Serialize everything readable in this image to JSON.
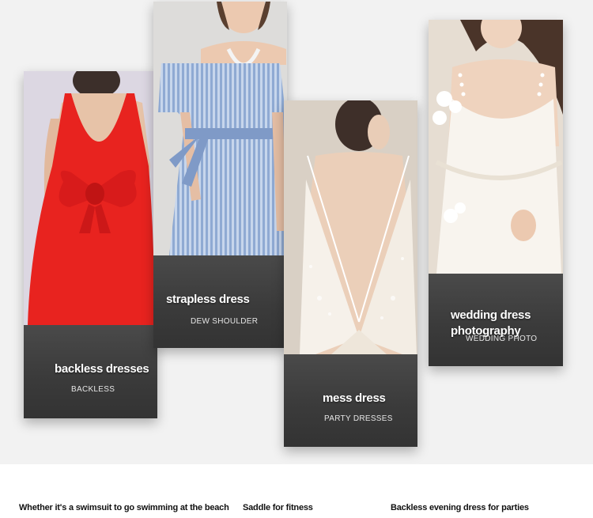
{
  "cards": [
    {
      "title": "backless dresses",
      "subtitle": "BACKLESS"
    },
    {
      "title": "strapless dress",
      "subtitle": "DEW SHOULDER"
    },
    {
      "title": "mess dress",
      "subtitle": "PARTY DRESSES"
    },
    {
      "title": "wedding dress photography",
      "subtitle": "WEDDING PHOTO"
    }
  ],
  "captions": [
    "Whether it's a swimsuit to go swimming at the beach",
    "Saddle for fitness",
    "Backless evening dress for parties"
  ],
  "colors": {
    "hero_bg": "#f2f2f2",
    "panel_dark": "#3b3b3b",
    "red_dress": "#e8231f",
    "stripe_blue": "#9fb6d8"
  }
}
